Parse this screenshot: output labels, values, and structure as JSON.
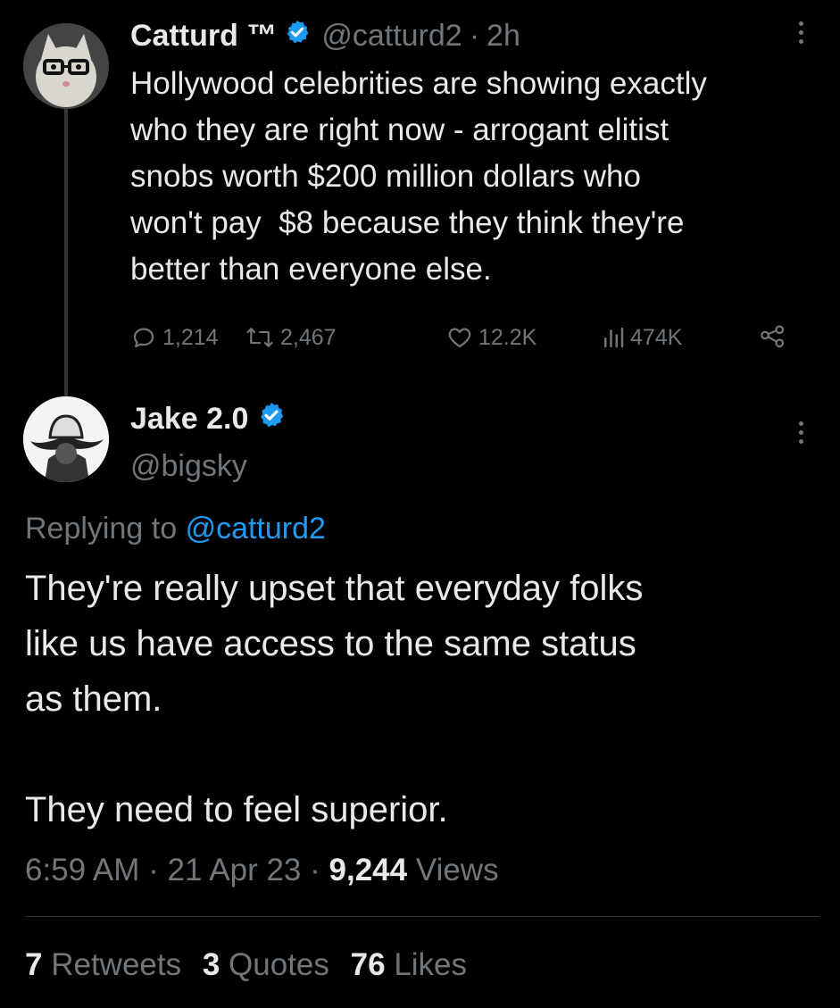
{
  "original_tweet": {
    "display_name": "Catturd ™",
    "handle": "@catturd2",
    "separator": "·",
    "time_ago": "2h",
    "text_lines": [
      "Hollywood celebrities are showing exactly",
      "who they are right now - arrogant elitist",
      "snobs worth $200 million dollars who",
      "won't pay  $8 because they think they're",
      "better than everyone else."
    ],
    "actions": {
      "replies": "1,214",
      "retweets": "2,467",
      "likes": "12.2K",
      "views": "474K"
    }
  },
  "reply_tweet": {
    "display_name": "Jake 2.0",
    "handle": "@bigsky",
    "replying_prefix": "Replying to",
    "replying_handle": "@catturd2",
    "text_lines": [
      "They're really upset that everyday folks",
      "like us have access to the same status",
      "as them."
    ],
    "text_line_last": "They need to feel superior.",
    "timestamp": "6:59 AM",
    "dot1": "·",
    "date": "21 Apr 23",
    "dot2": "·",
    "views_count": "9,244",
    "views_label": "Views",
    "stats": {
      "retweets_count": "7",
      "retweets_label": "Retweets",
      "quotes_count": "3",
      "quotes_label": "Quotes",
      "likes_count": "76",
      "likes_label": "Likes"
    }
  },
  "icons": {
    "verified": "verified-badge-icon",
    "more": "more-dots-icon",
    "reply": "reply-bubble-icon",
    "retweet": "retweet-arrows-icon",
    "like": "heart-icon",
    "views": "bar-chart-icon",
    "share": "share-icon"
  },
  "colors": {
    "background": "#000000",
    "text": "#e7e9ea",
    "muted": "#71767b",
    "link": "#1d9bf0",
    "verified": "#1d9bf0"
  }
}
